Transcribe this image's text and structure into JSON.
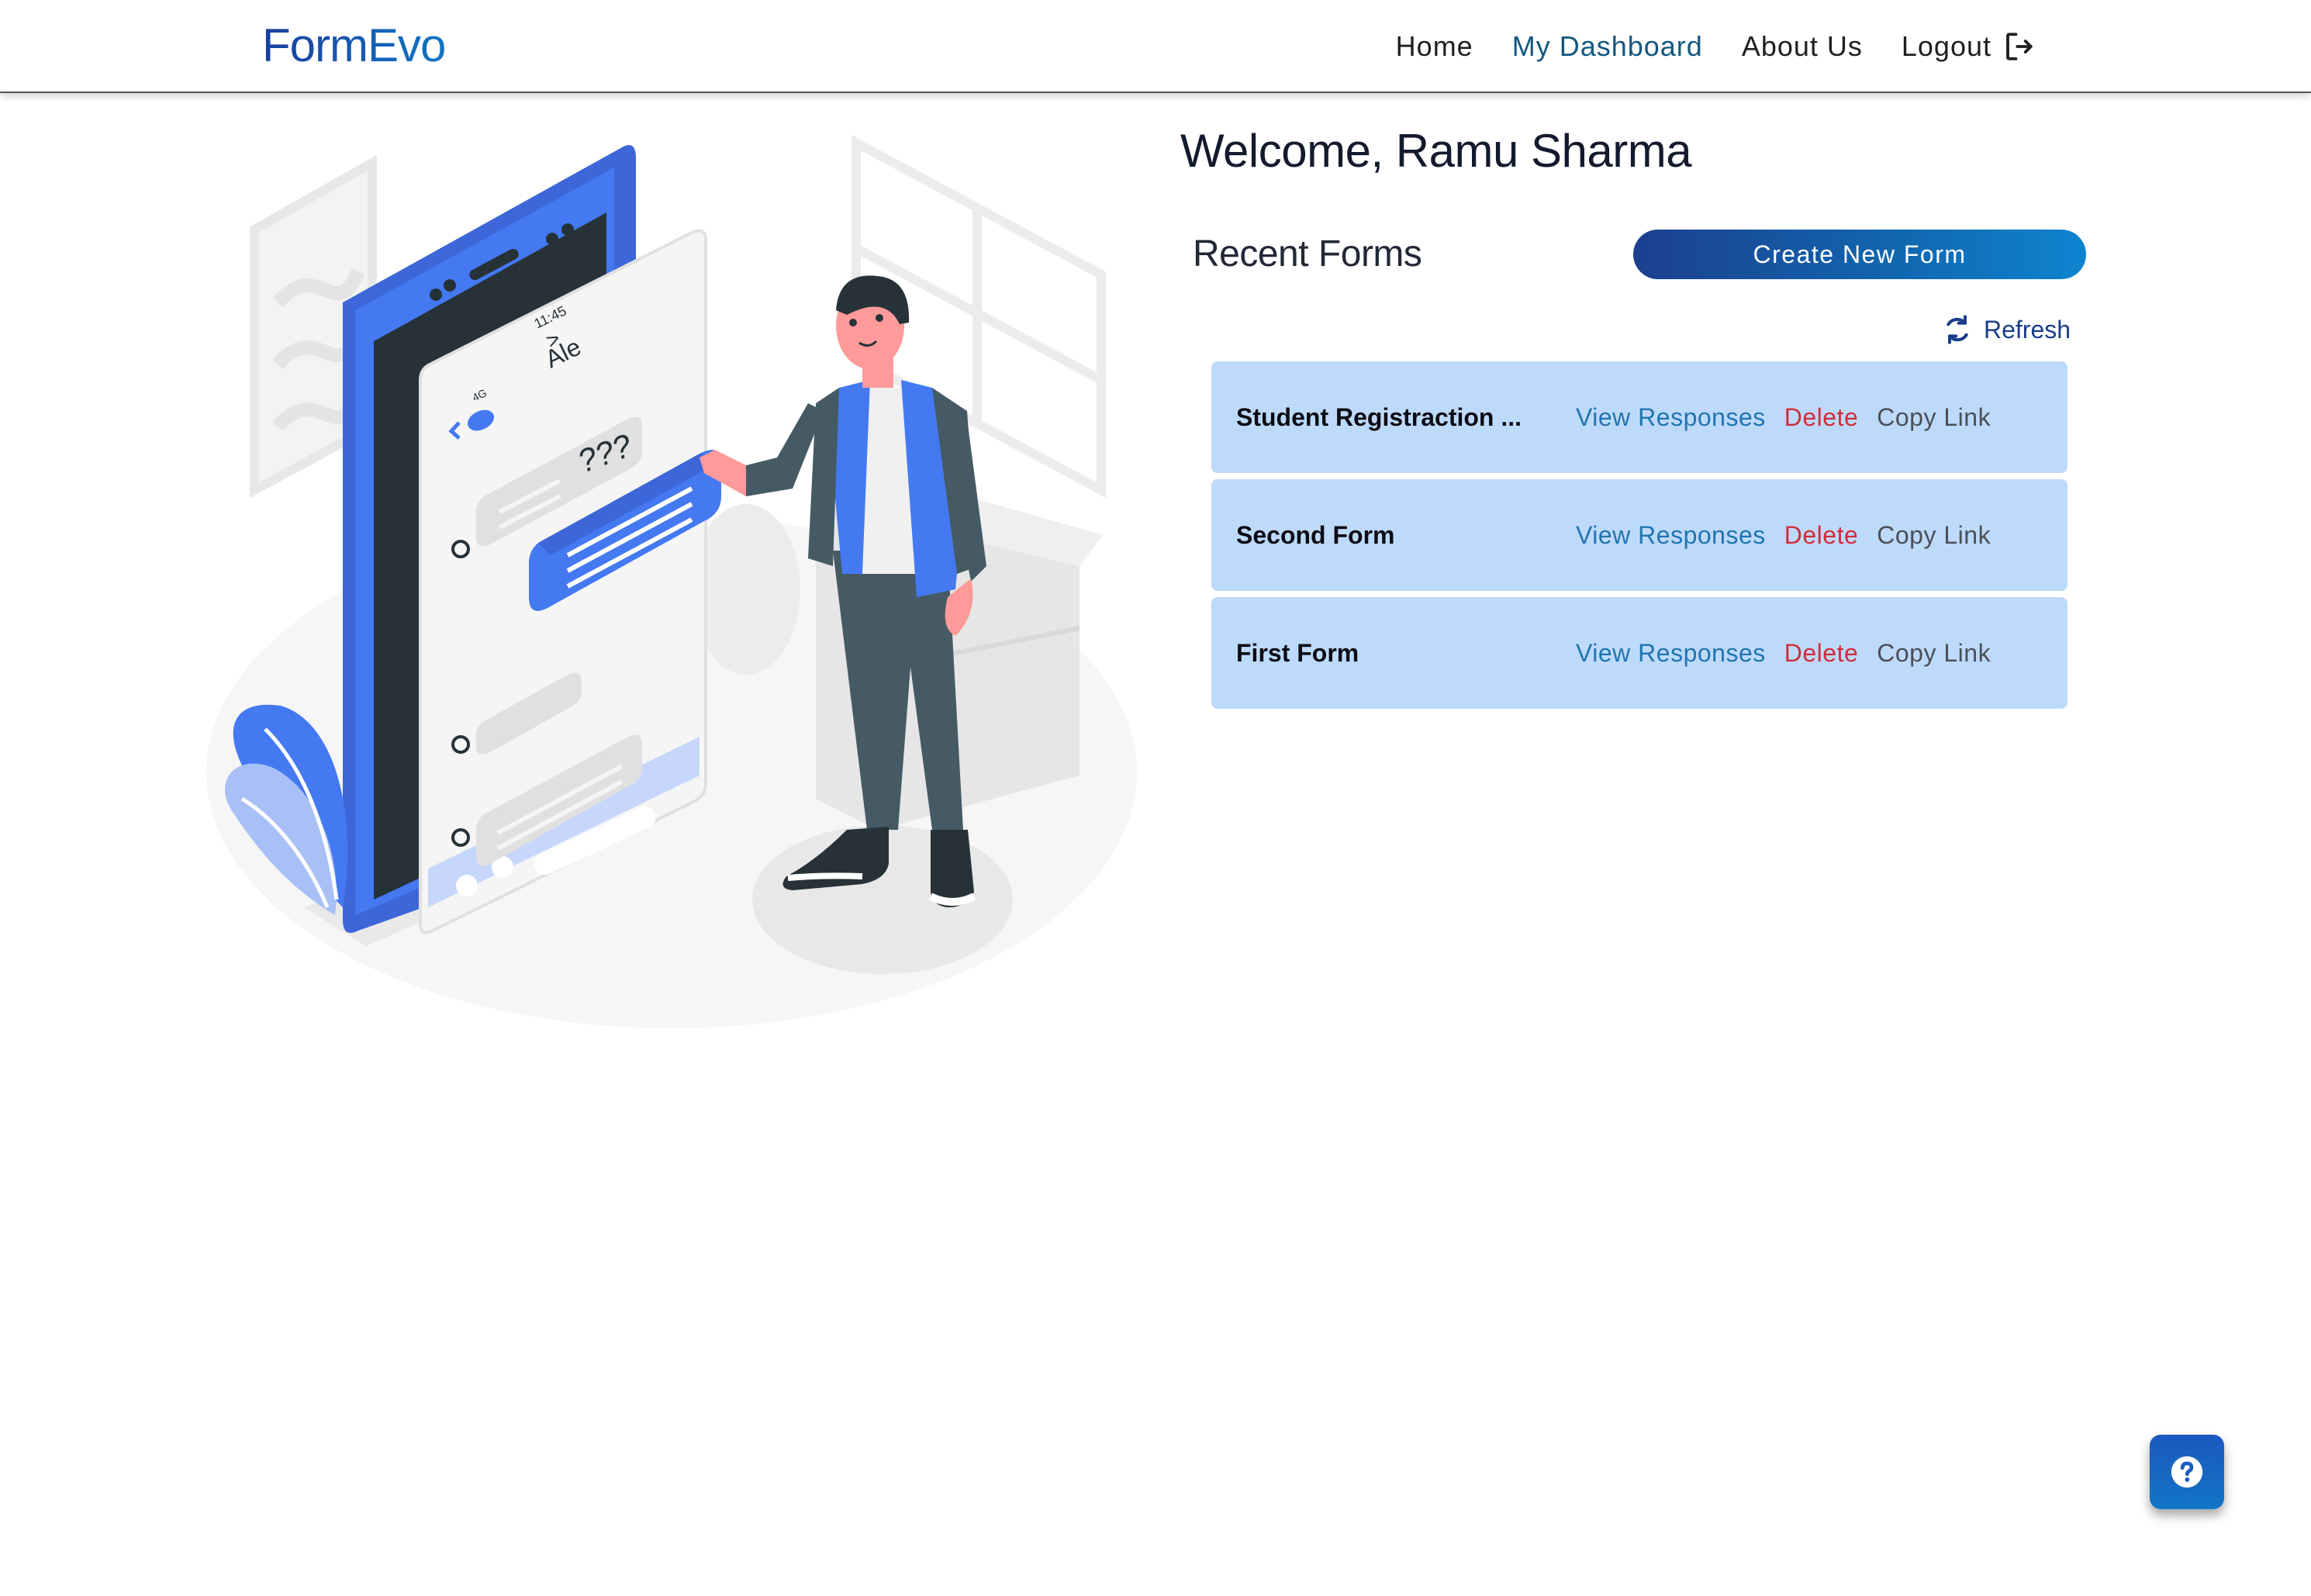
{
  "brand": {
    "name": "FormEvo"
  },
  "nav": {
    "home": "Home",
    "dashboard": "My Dashboard",
    "about": "About Us",
    "logout": "Logout"
  },
  "welcome": {
    "text": "Welcome, Ramu Sharma"
  },
  "recent": {
    "title": "Recent Forms",
    "create_label": "Create New Form",
    "refresh_label": "Refresh"
  },
  "forms": [
    {
      "name": "Student Registraction ...",
      "view": "View Responses",
      "delete": "Delete",
      "copy": "Copy Link"
    },
    {
      "name": "Second Form",
      "view": "View Responses",
      "delete": "Delete",
      "copy": "Copy Link"
    },
    {
      "name": "First Form",
      "view": "View Responses",
      "delete": "Delete",
      "copy": "Copy Link"
    }
  ],
  "illustration": {
    "time": "11:45",
    "network": "4G",
    "chat_name": "Ale",
    "bubble_text": "???"
  },
  "colors": {
    "brand": "#1a3f9e",
    "accent_blue": "#4479f2",
    "card_bg": "#bedafb",
    "view_link": "#2175b0",
    "delete_link": "#d12d3a",
    "copy_link": "#4b4f57",
    "active_nav": "#13577f"
  },
  "icons": {
    "logout": "logout-icon",
    "refresh": "refresh-icon",
    "help": "question-circle-icon"
  }
}
